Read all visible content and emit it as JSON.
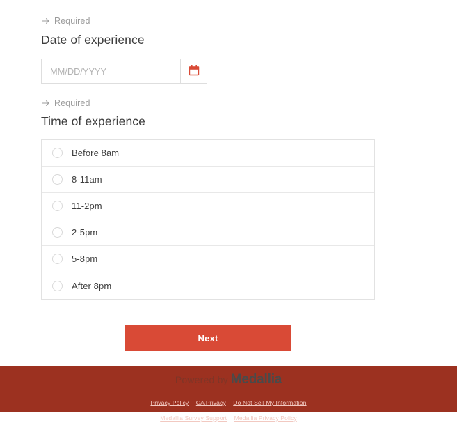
{
  "survey": {
    "date_section": {
      "required_label": "Required",
      "required_icon": "arrow-right-icon",
      "title": "Date of experience",
      "input_placeholder": "MM/DD/YYYY",
      "input_value": "",
      "calendar_icon": "calendar-icon"
    },
    "time_section": {
      "required_label": "Required",
      "required_icon": "arrow-right-icon",
      "title": "Time of experience",
      "options": [
        {
          "label": "Before 8am",
          "selected": false
        },
        {
          "label": "8-11am",
          "selected": false
        },
        {
          "label": "11-2pm",
          "selected": false
        },
        {
          "label": "2-5pm",
          "selected": false
        },
        {
          "label": "5-8pm",
          "selected": false
        },
        {
          "label": "After 8pm",
          "selected": false
        }
      ]
    },
    "next_button_label": "Next"
  },
  "footer": {
    "brand_prefix": "Powered by",
    "brand_name": "Medallia",
    "links_row1": [
      "Privacy Policy",
      "CA Privacy",
      "Do Not Sell My Information"
    ],
    "links_row2": [
      "Medallia Survey Support",
      "Medallia Privacy Policy"
    ],
    "background_color": "#9c3120"
  },
  "theme": {
    "accent_color": "#d94a36",
    "text_color": "#3d3d3d",
    "muted_color": "#9b9b9b",
    "border_color": "#e2e2e2"
  }
}
